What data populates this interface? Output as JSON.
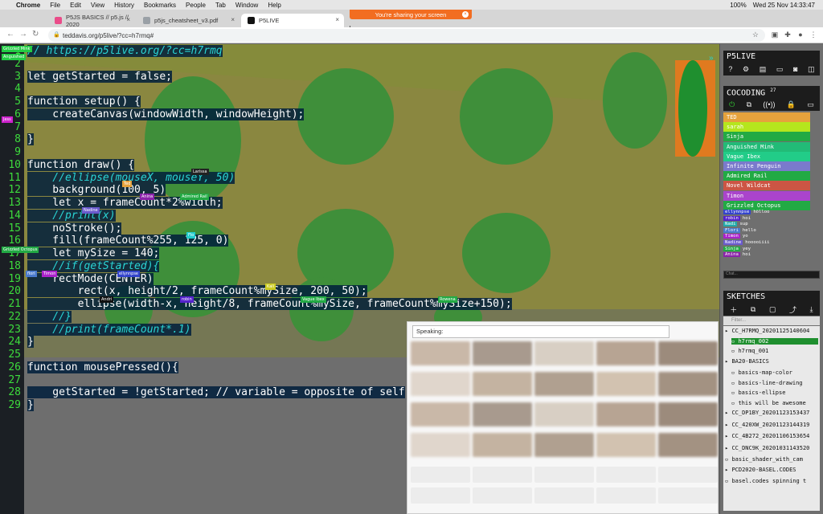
{
  "menubar": {
    "app": "Chrome",
    "items": [
      "File",
      "Edit",
      "View",
      "History",
      "Bookmarks",
      "People",
      "Tab",
      "Window",
      "Help"
    ],
    "battery": "100%",
    "clock": "Wed 25 Nov  14:33:47"
  },
  "share_banner": "You're sharing your screen",
  "tabs": [
    {
      "label": "P5JS BASICS // p5.js // 2020",
      "favicon_color": "#ea4c89"
    },
    {
      "label": "p5js_cheatsheet_v3.pdf",
      "favicon_color": "#9aa0a6"
    },
    {
      "label": "P5LIVE",
      "favicon_color": "#111111"
    }
  ],
  "address": "teddavis.org/p5live/?cc=h7rmq#",
  "code_lines": [
    "// https://p5live.org/?cc=h7rmq",
    "",
    "let getStarted = false;",
    "",
    "function setup() {",
    "    createCanvas(windowWidth, windowHeight);",
    "",
    "}",
    "",
    "function draw() {",
    "    //ellipse(mouseX, mouseY, 50)",
    "    background(100, 5)",
    "    let x = frameCount*2%width;",
    "    //print(x)",
    "    noStroke();",
    "    fill(frameCount%255, 125, 0)",
    "    let mySize = 140;",
    "    //if(getStarted){",
    "    rectMode(CENTER)",
    "        rect(x, height/2, frameCount%mySize, 200, 50);",
    "        ellipse(width-x, height/8, frameCount%mySize, frameCount%mySize+150);",
    "    //}",
    "    //print(frameCount*.1)",
    "}",
    "",
    "function mousePressed(){",
    "",
    "    getStarted = !getStarted; // variable = opposite of self",
    "}"
  ],
  "line_numbers": [
    "1",
    "2",
    "3",
    "4",
    "5",
    "6",
    "7",
    "8",
    "9",
    "10",
    "11",
    "12",
    "13",
    "14",
    "15",
    "16",
    "17",
    "18",
    "19",
    "20",
    "21",
    "22",
    "23",
    "24",
    "25",
    "26",
    "27",
    "28",
    "29"
  ],
  "cursor_tags": [
    {
      "label": "Grizzled Mink",
      "color": "#22cc44"
    },
    {
      "label": "Anguished",
      "color": "#22cc44"
    },
    {
      "label": "Jess",
      "color": "#cc22cc"
    },
    {
      "label": "Larissa",
      "color": "#222222"
    },
    {
      "label": "Ted",
      "color": "#e6a23c"
    },
    {
      "label": "Anina",
      "color": "#8b22aa"
    },
    {
      "label": "Admired Rail",
      "color": "#22aa44"
    },
    {
      "label": "Nadine",
      "color": "#6a5acd"
    },
    {
      "label": "Flo",
      "color": "#22cccc"
    },
    {
      "label": "Grizzled Octopus",
      "color": "#22aa44"
    },
    {
      "label": "flori",
      "color": "#4a7acc"
    },
    {
      "label": "Timon",
      "color": "#aa22cc"
    },
    {
      "label": "ellynnpse",
      "color": "#3344cc"
    },
    {
      "label": "Andri",
      "color": "#111111"
    },
    {
      "label": "robin",
      "color": "#5522cc"
    },
    {
      "label": "Kali",
      "color": "#cccc22"
    },
    {
      "label": "Vague Ibex",
      "color": "#22aa44"
    },
    {
      "label": "Rowena",
      "color": "#22aa44"
    }
  ],
  "panel": {
    "title": "P5LIVE",
    "cocoding_title": "COCODING",
    "cocoding_count": "27",
    "users": [
      {
        "name": "TED",
        "color": "#e6a23c"
      },
      {
        "name": "sarah",
        "color": "#b5e61d"
      },
      {
        "name": "Sinja",
        "color": "#22aa44"
      },
      {
        "name": "Anguished Mink",
        "color": "#22bb77"
      },
      {
        "name": "Vague Ibex",
        "color": "#22cc88"
      },
      {
        "name": "Infinite Penguin",
        "color": "#7a7acc"
      },
      {
        "name": "Admired Rail",
        "color": "#22aa44"
      },
      {
        "name": "Novel Wildcat",
        "color": "#cc5544"
      },
      {
        "name": "Timon",
        "color": "#aa44cc"
      },
      {
        "name": "Grizzled Octopus",
        "color": "#22aa44"
      }
    ],
    "chat": [
      {
        "who": "ellynnpse",
        "msg": "hölloo",
        "color": "#3344cc"
      },
      {
        "who": "robin",
        "msg": "hoi",
        "color": "#5522cc"
      },
      {
        "who": "Nadi",
        "msg": "sup",
        "color": "#22aaaa"
      },
      {
        "who": "Flori",
        "msg": "hello",
        "color": "#4a7acc"
      },
      {
        "who": "Timon",
        "msg": "yo",
        "color": "#aa22cc"
      },
      {
        "who": "Nadine",
        "msg": "hooooiiii",
        "color": "#6a5acd"
      },
      {
        "who": "Sinja",
        "msg": "yey",
        "color": "#22aa44"
      },
      {
        "who": "Anina",
        "msg": "hoi",
        "color": "#8b22aa"
      }
    ],
    "chat_placeholder": "Chat...",
    "sketches_title": "SKETCHES",
    "filter_placeholder": "Filter...",
    "sketches": [
      {
        "label": "CC_H7RMQ_20201125140604",
        "level": 0,
        "folder": true
      },
      {
        "label": "h7rmq_002",
        "level": 1,
        "folder": false,
        "selected": true
      },
      {
        "label": "h7rmq_001",
        "level": 1,
        "folder": false
      },
      {
        "label": "BA20-BASICS",
        "level": 0,
        "folder": true
      },
      {
        "label": "basics-map-color",
        "level": 1,
        "folder": false
      },
      {
        "label": "basics-line-drawing",
        "level": 1,
        "folder": false
      },
      {
        "label": "basics-ellipse",
        "level": 1,
        "folder": false
      },
      {
        "label": "this will be awesome",
        "level": 1,
        "folder": false
      },
      {
        "label": "CC_DP1BY_20201123153437",
        "level": 0,
        "folder": true
      },
      {
        "label": "CC_420XW_20201123144319",
        "level": 0,
        "folder": true
      },
      {
        "label": "CC_4B272_20201106153654",
        "level": 0,
        "folder": true
      },
      {
        "label": "CC_DNC9K_20201031143520",
        "level": 0,
        "folder": true
      },
      {
        "label": "basic_shader_with_cam",
        "level": 0,
        "folder": false
      },
      {
        "label": "PCD2020-BASEL.CODES",
        "level": 0,
        "folder": true
      },
      {
        "label": "basel.codes spinning t",
        "level": 0,
        "folder": false
      }
    ]
  },
  "video": {
    "speaking_label": "Speaking:"
  }
}
